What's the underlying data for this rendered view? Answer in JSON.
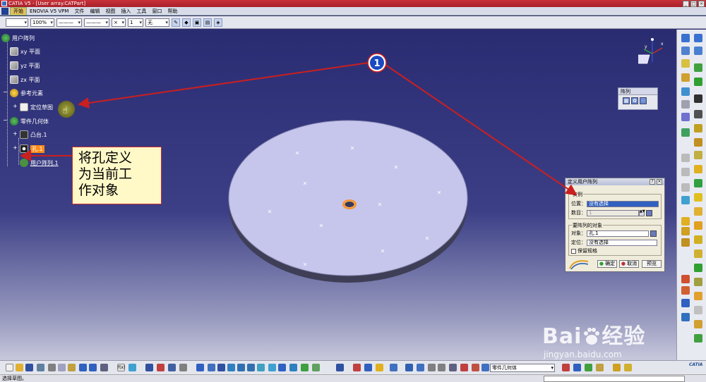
{
  "window": {
    "title": "CATIA V5 - [User array.CATPart]"
  },
  "menu": [
    "开始",
    "ENOVIA V5 VPM",
    "文件",
    "编辑",
    "视图",
    "插入",
    "工具",
    "窗口",
    "帮助"
  ],
  "toolbar_top": {
    "zoom": "100%",
    "line_weight": "1",
    "layer": "无"
  },
  "tree": {
    "root": "用户阵列",
    "planes": [
      "xy 平面",
      "yz 平面",
      "zx 平面"
    ],
    "ref_elements": "参考元素",
    "positioning_sketch": "定位草图",
    "body": "零件几何体",
    "pad": "凸台.1",
    "hole": "孔.1",
    "user_pattern": "用户阵列.1"
  },
  "annotation": {
    "marker": "1",
    "note_lines": [
      "将孔定义",
      "为当前工",
      "作对象"
    ]
  },
  "compass": {
    "axis_x": "x",
    "axis_y": "y"
  },
  "pattern_toolbar": {
    "title": "阵列"
  },
  "dialog": {
    "title": "定义用户阵列",
    "instances_legend": "实例",
    "position_label": "位置：",
    "position_value": "没有选择",
    "count_label": "数目：",
    "count_value": "1",
    "object_legend": "要阵列的对象",
    "object_label": "对象：",
    "object_value": "孔.1",
    "anchor_label": "定位：",
    "anchor_value": "没有选择",
    "keep_spec_label": "保留规格",
    "ok": "确定",
    "cancel": "取消",
    "preview": "预览"
  },
  "bottom_toolbar": {
    "body_combo": "零件几何体"
  },
  "status": {
    "text": "选择草图。"
  },
  "watermark": {
    "brand": "Bai",
    "brand2": "经验",
    "url": "jingyan.baidu.com"
  },
  "colors": {
    "viewport_top": "#2a2c72",
    "disc": "#c6c6ec",
    "highlight": "#ff8c1a",
    "arrow": "#cc1f1f",
    "note_bg": "#fff9c8"
  }
}
